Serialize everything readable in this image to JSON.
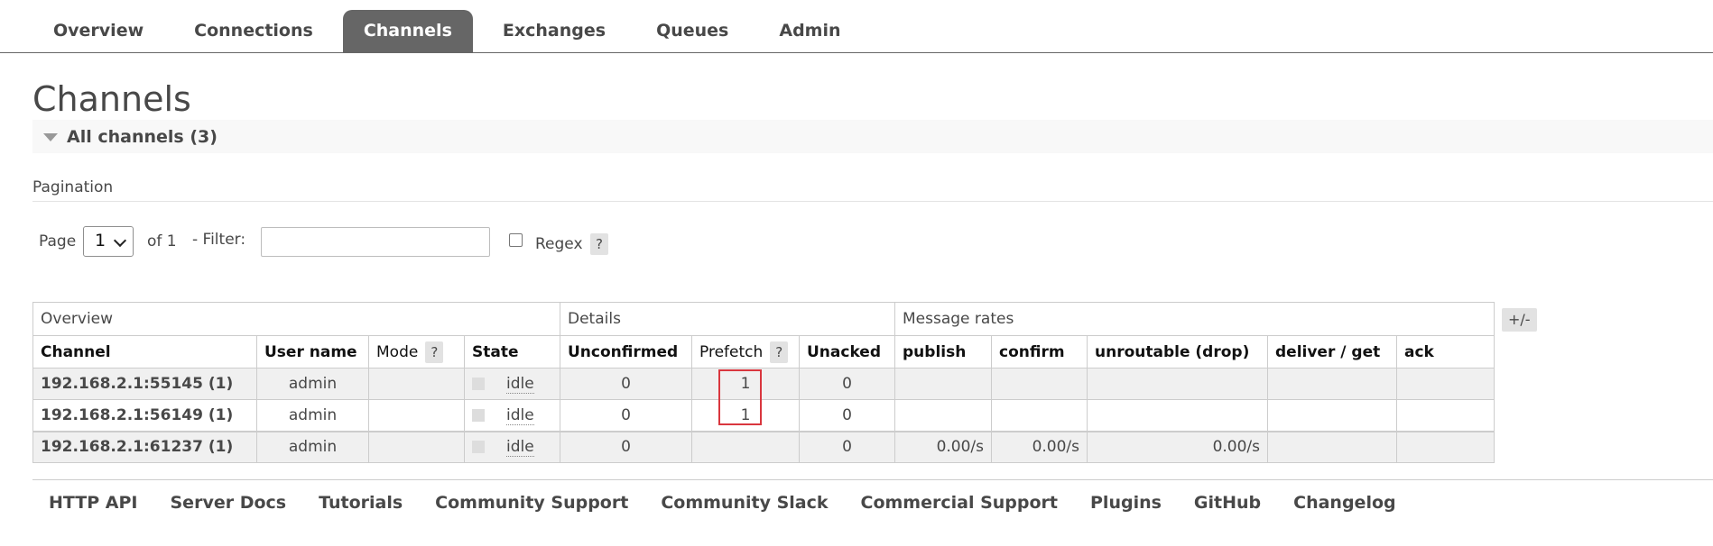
{
  "nav": {
    "tabs": [
      {
        "label": "Overview"
      },
      {
        "label": "Connections"
      },
      {
        "label": "Channels",
        "selected": true
      },
      {
        "label": "Exchanges"
      },
      {
        "label": "Queues"
      },
      {
        "label": "Admin"
      }
    ]
  },
  "page": {
    "title": "Channels",
    "section_label": "All channels (3)"
  },
  "pagination": {
    "title": "Pagination",
    "page_label": "Page",
    "page_value": "1",
    "of_label": "of 1",
    "filter_label": "- Filter:",
    "filter_value": "",
    "regex_label": "Regex",
    "help_label": "?"
  },
  "table": {
    "groups": [
      "Overview",
      "Details",
      "Message rates"
    ],
    "columns": [
      "Channel",
      "User name",
      "Mode",
      "State",
      "Unconfirmed",
      "Prefetch",
      "Unacked",
      "publish",
      "confirm",
      "unroutable (drop)",
      "deliver / get",
      "ack"
    ],
    "help_label": "?",
    "toggle_label": "+/-",
    "rows": [
      {
        "channel": "192.168.2.1:55145 (1)",
        "user": "admin",
        "mode": "",
        "state": "idle",
        "unconfirmed": "0",
        "prefetch": "1",
        "unacked": "0",
        "publish": "",
        "confirm": "",
        "unroutable": "",
        "deliver_get": "",
        "ack": ""
      },
      {
        "channel": "192.168.2.1:56149 (1)",
        "user": "admin",
        "mode": "",
        "state": "idle",
        "unconfirmed": "0",
        "prefetch": "1",
        "unacked": "0",
        "publish": "",
        "confirm": "",
        "unroutable": "",
        "deliver_get": "",
        "ack": ""
      },
      {
        "channel": "192.168.2.1:61237 (1)",
        "user": "admin",
        "mode": "",
        "state": "idle",
        "unconfirmed": "0",
        "prefetch": "",
        "unacked": "0",
        "publish": "0.00/s",
        "confirm": "0.00/s",
        "unroutable": "0.00/s",
        "deliver_get": "",
        "ack": ""
      }
    ]
  },
  "footer": {
    "links": [
      "HTTP API",
      "Server Docs",
      "Tutorials",
      "Community Support",
      "Community Slack",
      "Commercial Support",
      "Plugins",
      "GitHub",
      "Changelog"
    ]
  },
  "colors": {
    "nav_selected_bg": "#666666",
    "highlight_border": "#d9363e",
    "row_alt_bg": "#f0f0f0"
  }
}
